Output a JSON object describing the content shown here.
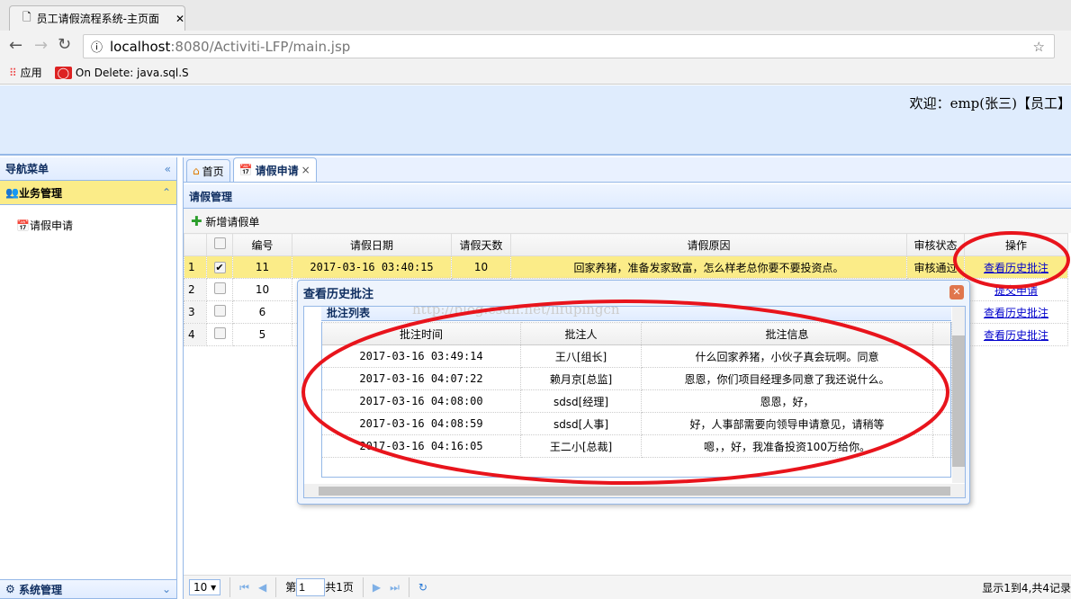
{
  "browser": {
    "tab_title": "员工请假流程系统-主页面",
    "url_host": "localhost",
    "url_rest": ":8080/Activiti-LFP/main.jsp",
    "bookmarks": [
      {
        "label": "应用"
      },
      {
        "label": "On Delete: java.sql.S"
      }
    ]
  },
  "header": {
    "welcome": "欢迎：emp(张三)【员工】"
  },
  "sidebar": {
    "title": "导航菜单",
    "group": "业务管理",
    "items": [
      {
        "label": "请假申请"
      }
    ],
    "bottom_group": "系统管理"
  },
  "tabs": [
    {
      "label": "首页"
    },
    {
      "label": "请假申请",
      "close": "×"
    }
  ],
  "panel": {
    "title": "请假管理",
    "add_button": "新增请假单"
  },
  "grid": {
    "columns": [
      "编号",
      "请假日期",
      "请假天数",
      "请假原因",
      "审核状态",
      "操作"
    ],
    "rows": [
      {
        "n": "1",
        "checked": true,
        "id": "11",
        "date": "2017-03-16 03:40:15",
        "days": "10",
        "reason": "回家养猪，准备发家致富，怎么样老总你要不要投资点。",
        "status": "审核通过",
        "action": "查看历史批注"
      },
      {
        "n": "2",
        "checked": false,
        "id": "10",
        "date": "",
        "days": "",
        "reason": "",
        "status": "",
        "action": "提交申请"
      },
      {
        "n": "3",
        "checked": false,
        "id": "6",
        "date": "",
        "days": "",
        "reason": "",
        "status": "",
        "action": "查看历史批注"
      },
      {
        "n": "4",
        "checked": false,
        "id": "5",
        "date": "",
        "days": "",
        "reason": "",
        "status": "",
        "action": "查看历史批注"
      }
    ]
  },
  "dialog": {
    "title": "查看历史批注",
    "list_title": "批注列表",
    "watermark": "http://blog.csdn.net/lifupingcn",
    "columns": [
      "批注时间",
      "批注人",
      "批注信息"
    ],
    "rows": [
      {
        "time": "2017-03-16 03:49:14",
        "user": "王八[组长]",
        "msg": "什么回家养猪，小伙子真会玩啊。同意"
      },
      {
        "time": "2017-03-16 04:07:22",
        "user": "赖月京[总监]",
        "msg": "恩恩，你们项目经理多同意了我还说什么。"
      },
      {
        "time": "2017-03-16 04:08:00",
        "user": "sdsd[经理]",
        "msg": "恩恩，好，"
      },
      {
        "time": "2017-03-16 04:08:59",
        "user": "sdsd[人事]",
        "msg": "好，人事部需要向领导申请意见，请稍等"
      },
      {
        "time": "2017-03-16 04:16:05",
        "user": "王二小[总裁]",
        "msg": "嗯，，好，我准备投资100万给你。"
      }
    ]
  },
  "pager": {
    "page_size": "10",
    "page_label": "第",
    "page": "1",
    "total_pages": "共1页",
    "summary": "显示1到4,共4记录"
  },
  "colors": {
    "header_bg": "#dfecfd",
    "selected_row": "#fbec88",
    "annotation": "#e8141c"
  }
}
